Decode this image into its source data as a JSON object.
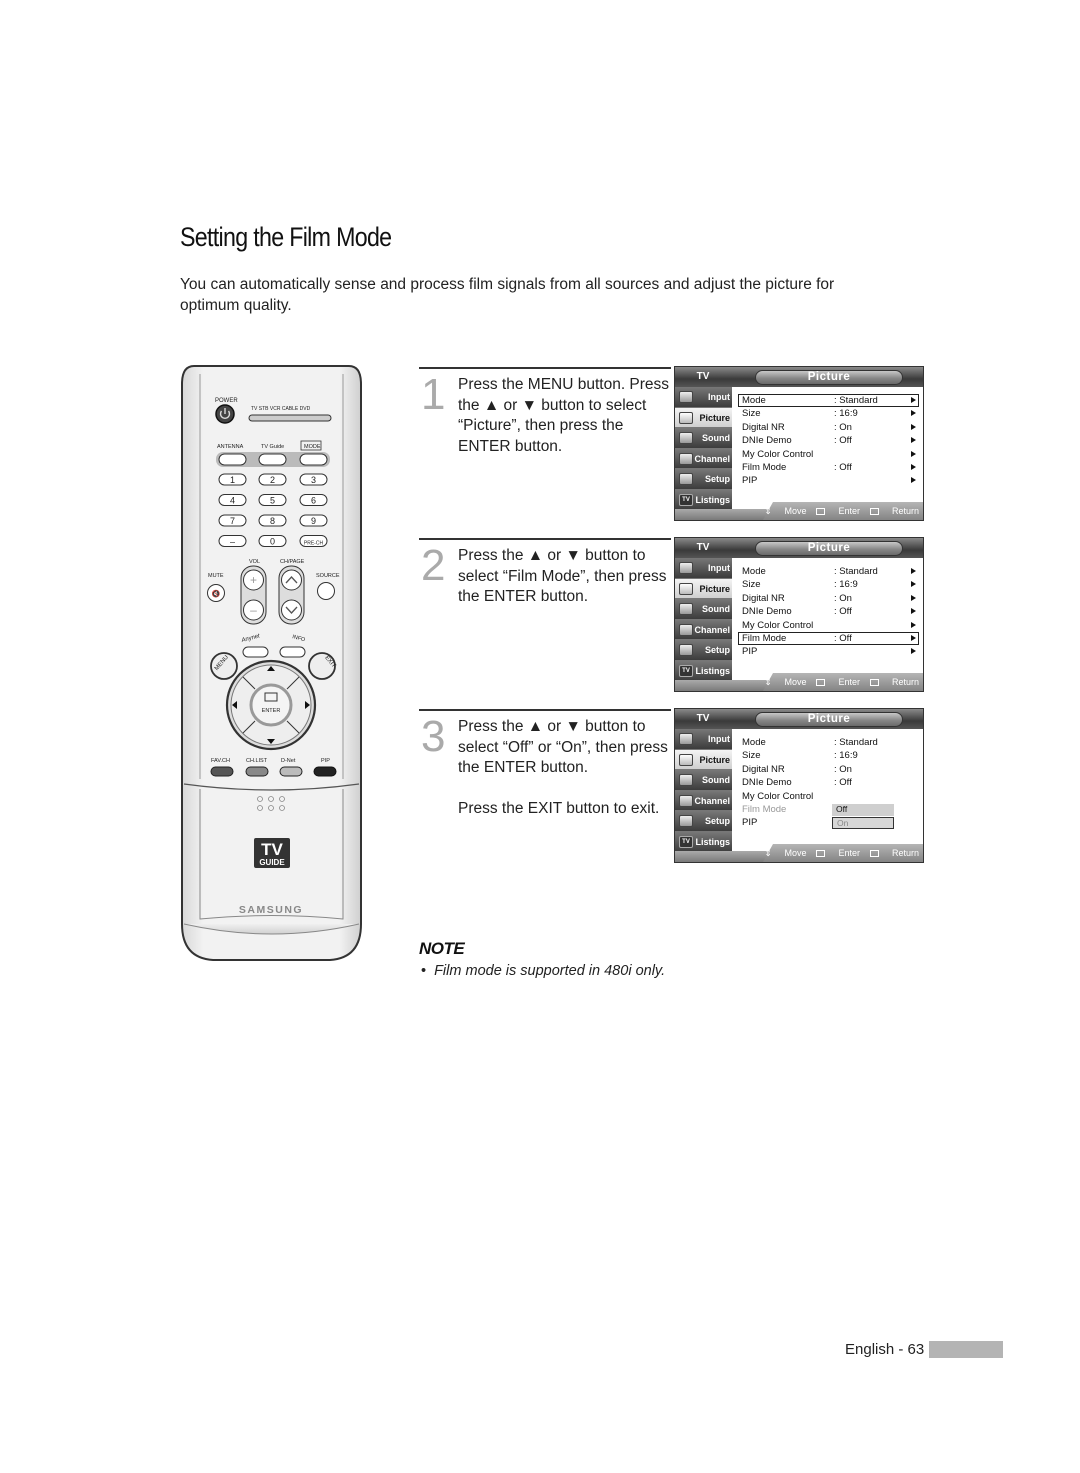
{
  "page": {
    "title": "Setting the Film Mode",
    "intro": "You can automatically sense and process film signals from all sources and adjust the picture for optimum quality."
  },
  "remote": {
    "labels": {
      "power": "POWER",
      "sources": "TV   STB   VCR   CABLE   DVD",
      "antenna": "ANTENNA",
      "tv_guide": "TV Guide",
      "mode": "MODE",
      "vol": "VOL",
      "chpage": "CH/PAGE",
      "mute": "MUTE",
      "source": "SOURCE",
      "anynet": "Anynet",
      "info": "INFO",
      "menu": "MENU",
      "exit": "EXIT",
      "enter": "ENTER",
      "fav_ch": "FAV.CH",
      "ch_list": "CH.LIST",
      "d_net": "D-Net",
      "pip": "PIP",
      "guide_logo_top": "TV",
      "guide_logo_bottom": "GUIDE",
      "brand": "SAMSUNG"
    },
    "keys": [
      "1",
      "2",
      "3",
      "4",
      "5",
      "6",
      "7",
      "8",
      "9",
      "–",
      "0",
      "PRE-CH"
    ]
  },
  "steps": [
    {
      "number": "1",
      "lines": [
        "Press the MENU button. Press the ▲ or ▼ button to select “Picture”, then press the ENTER button."
      ]
    },
    {
      "number": "2",
      "lines": [
        "Press the ▲ or ▼ button to select “Film Mode”, then press the ENTER button."
      ]
    },
    {
      "number": "3",
      "lines": [
        "Press the ▲ or ▼ button to select “Off” or “On”, then press the ENTER button.",
        "Press the EXIT button to exit."
      ]
    }
  ],
  "osd": {
    "tv_label": "TV",
    "title": "Picture",
    "tabs": [
      "Input",
      "Picture",
      "Sound",
      "Channel",
      "Setup",
      "Listings"
    ],
    "active_tab": "Picture",
    "rows": [
      {
        "label": "Mode",
        "value": ": Standard"
      },
      {
        "label": "Size",
        "value": ": 16:9"
      },
      {
        "label": "Digital NR",
        "value": ": On"
      },
      {
        "label": "DNIe Demo",
        "value": ": Off"
      },
      {
        "label": "My Color Control",
        "value": ""
      },
      {
        "label": "Film Mode",
        "value": ": Off"
      },
      {
        "label": "PIP",
        "value": ""
      }
    ],
    "help": {
      "move": "Move",
      "enter": "Enter",
      "return": "Return"
    },
    "screens": [
      {
        "selected_row": "Mode"
      },
      {
        "selected_row": "Film Mode"
      },
      {
        "selected_row": "Film Mode",
        "options": [
          "Off",
          "On"
        ],
        "highlighted_option": "On"
      }
    ]
  },
  "note": {
    "title": "NOTE",
    "items": [
      "Film mode is supported in 480i only."
    ]
  },
  "footer": {
    "page_label": "English - 63"
  }
}
